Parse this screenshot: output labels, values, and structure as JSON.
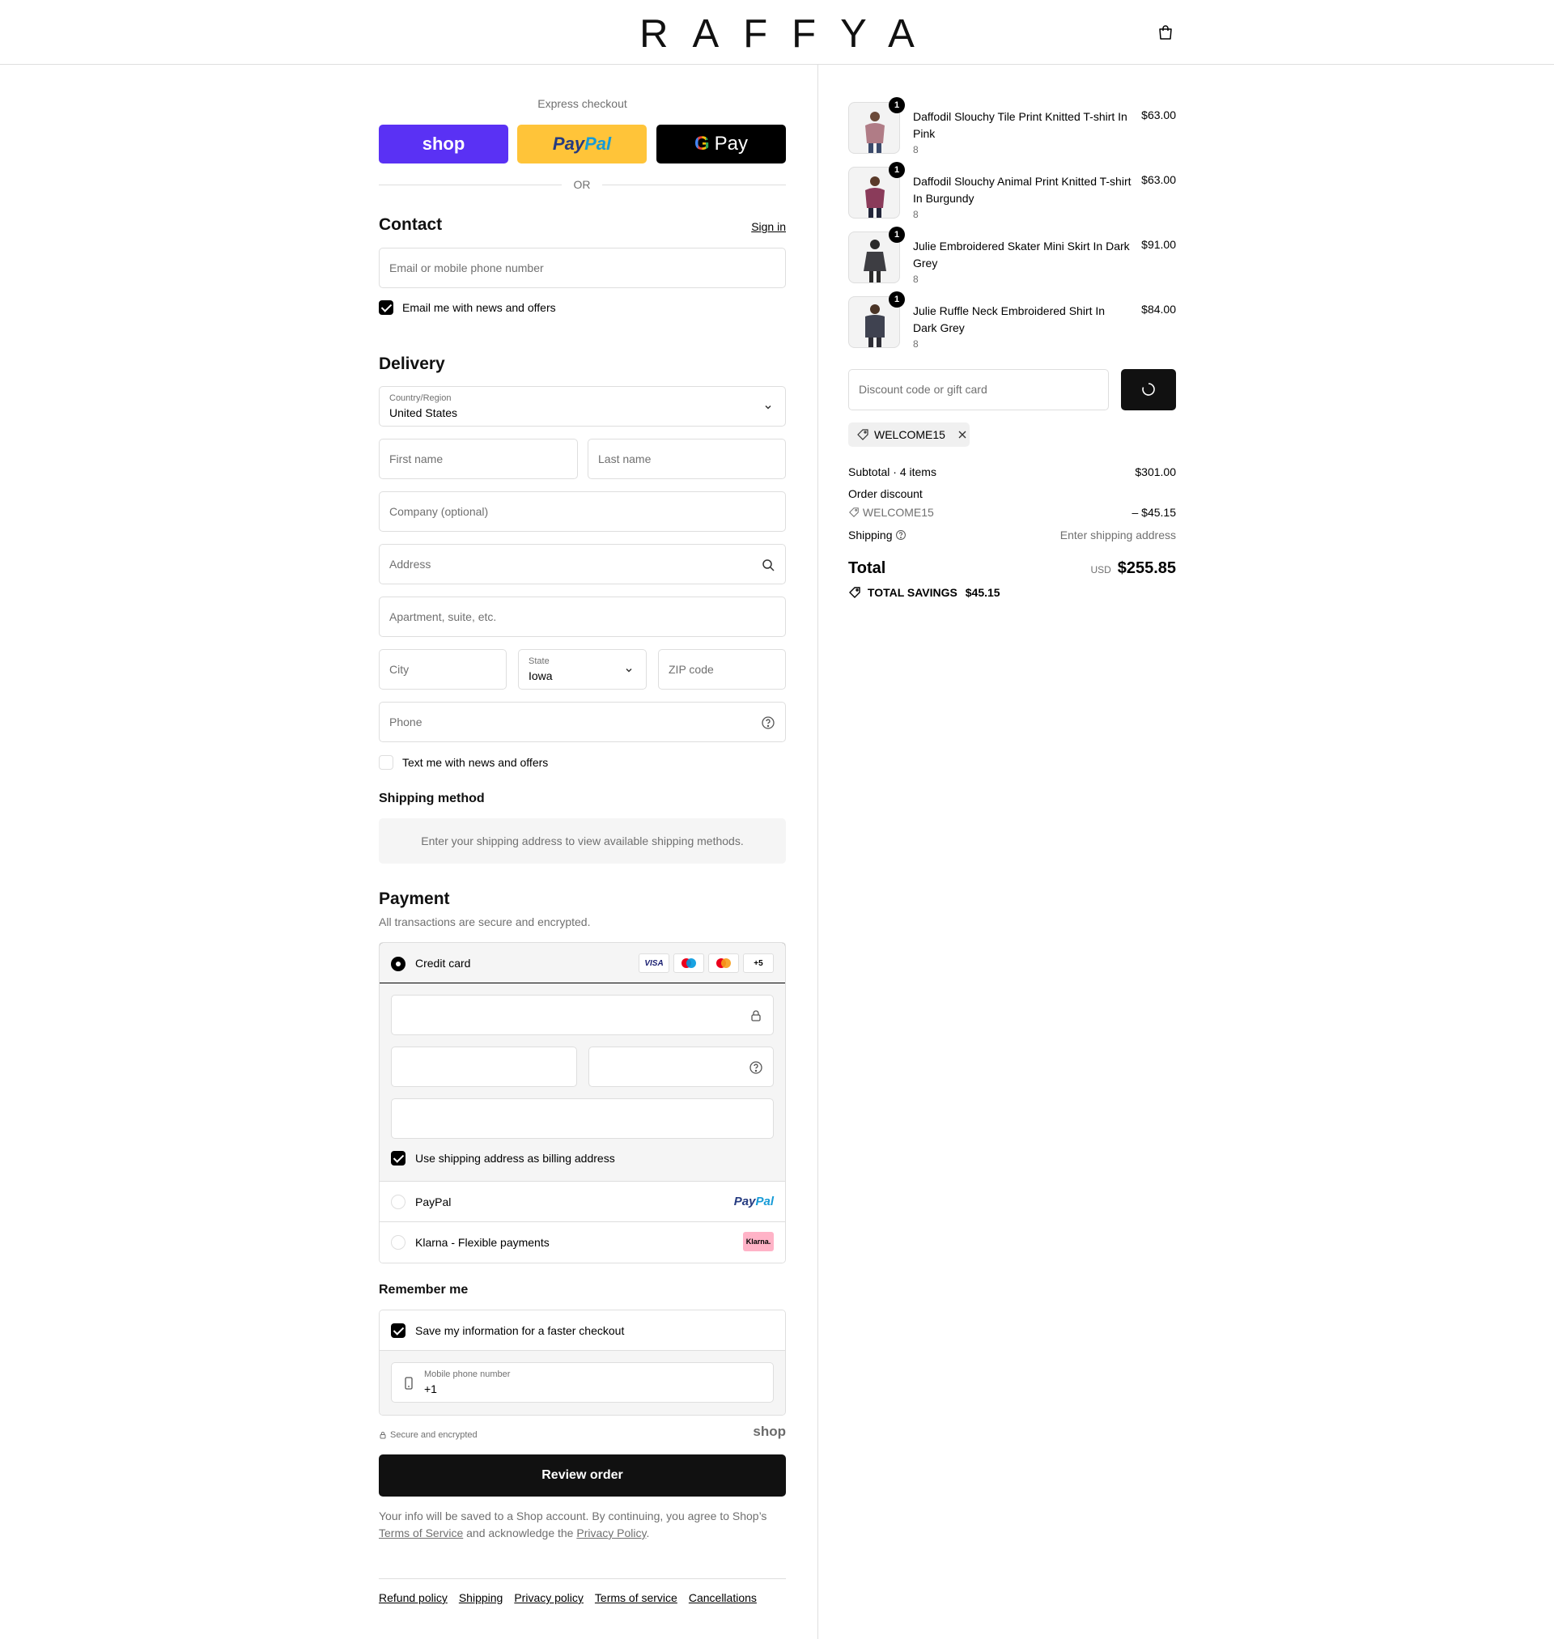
{
  "header": {
    "brand": "RAFFYA"
  },
  "express": {
    "title": "Express checkout",
    "shop_label": "shop",
    "paypal_a": "Pay",
    "paypal_b": "Pal",
    "gpay_label": "Pay",
    "or": "OR"
  },
  "contact": {
    "title": "Contact",
    "sign_in": "Sign in",
    "email_placeholder": "Email or mobile phone number",
    "news_label": "Email me with news and offers"
  },
  "delivery": {
    "title": "Delivery",
    "country_label": "Country/Region",
    "country_value": "United States",
    "first_name": "First name",
    "last_name": "Last name",
    "company": "Company (optional)",
    "address": "Address",
    "apartment": "Apartment, suite, etc.",
    "city": "City",
    "state_label": "State",
    "state_value": "Iowa",
    "zip": "ZIP code",
    "phone": "Phone",
    "text_label": "Text me with news and offers"
  },
  "shipping_method": {
    "title": "Shipping method",
    "message": "Enter your shipping address to view available shipping methods."
  },
  "payment": {
    "title": "Payment",
    "subtitle": "All transactions are secure and encrypted.",
    "credit_card": "Credit card",
    "brands": [
      "VISA",
      "+5"
    ],
    "billing_label": "Use shipping address as billing address",
    "paypal": "PayPal",
    "paypal_logo_a": "Pay",
    "paypal_logo_b": "Pal",
    "klarna": "Klarna - Flexible payments",
    "klarna_logo": "Klarna."
  },
  "remember": {
    "title": "Remember me",
    "save_label": "Save my information for a faster checkout",
    "mobile_label": "Mobile phone number",
    "mobile_value": "+1",
    "secure": "Secure and encrypted",
    "shop_logo": "shop"
  },
  "review_button": "Review order",
  "legal": {
    "part1": "Your info will be saved to a Shop account. By continuing, you agree to Shop’s",
    "terms": "Terms of Service",
    "part2": "and acknowledge the",
    "privacy": "Privacy Policy",
    "part3": "."
  },
  "footer_links": [
    "Refund policy",
    "Shipping",
    "Privacy policy",
    "Terms of service",
    "Cancellations"
  ],
  "cart": {
    "items": [
      {
        "name": "Daffodil Slouchy Tile Print Knitted T-shirt In Pink",
        "variant": "8",
        "price": "$63.00",
        "qty": "1",
        "color": "#b07c86"
      },
      {
        "name": "Daffodil Slouchy Animal Print Knitted T-shirt In Burgundy",
        "variant": "8",
        "price": "$63.00",
        "qty": "1",
        "color": "#8a3b5a"
      },
      {
        "name": "Julie Embroidered Skater Mini Skirt In Dark Grey",
        "variant": "8",
        "price": "$91.00",
        "qty": "1",
        "color": "#3d3d42"
      },
      {
        "name": "Julie Ruffle Neck Embroidered Shirt In Dark Grey",
        "variant": "8",
        "price": "$84.00",
        "qty": "1",
        "color": "#3f4250"
      }
    ],
    "discount_placeholder": "Discount code or gift card",
    "applied_code": "WELCOME15",
    "subtotal_label": "Subtotal · 4 items",
    "subtotal_value": "$301.00",
    "order_discount_label": "Order discount",
    "discount_code": "WELCOME15",
    "discount_value": "– $45.15",
    "shipping_label": "Shipping",
    "shipping_value": "Enter shipping address",
    "total_label": "Total",
    "currency": "USD",
    "total_value": "$255.85",
    "savings_label": "TOTAL SAVINGS",
    "savings_value": "$45.15"
  }
}
